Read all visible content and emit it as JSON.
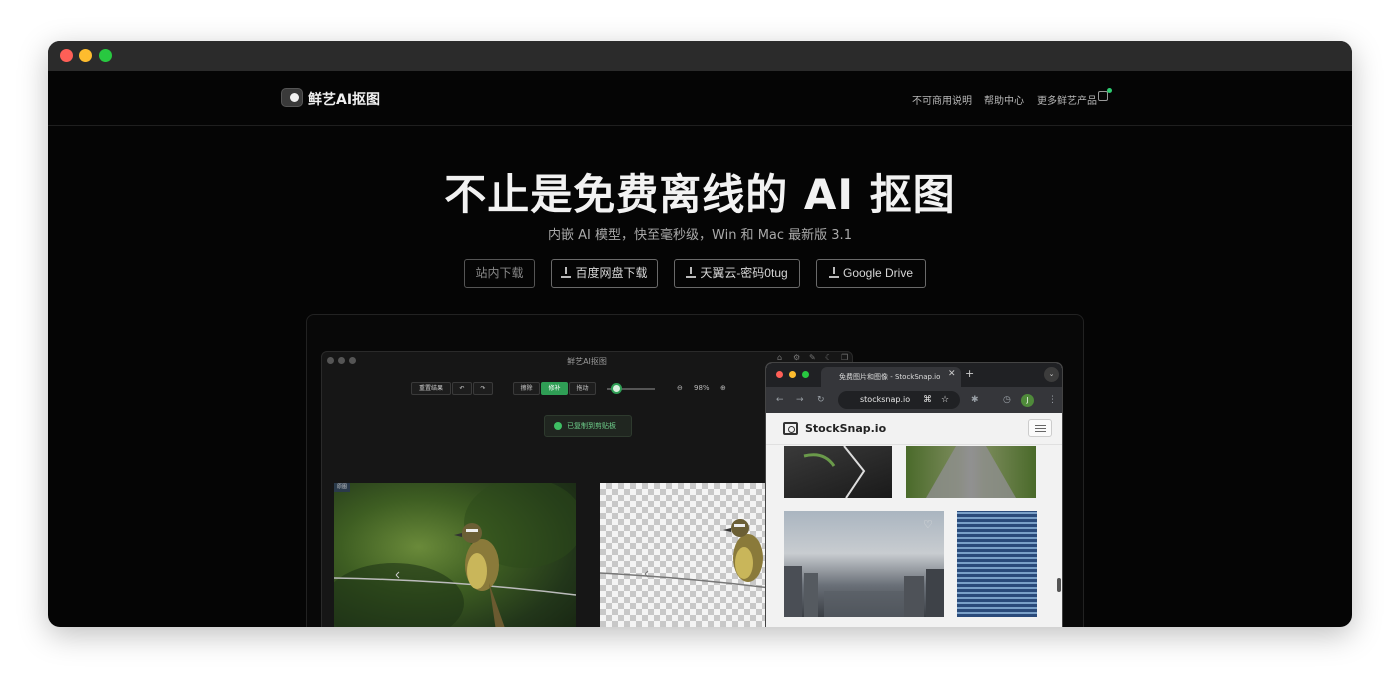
{
  "window": {
    "traffic_lights": [
      "#ff5f57",
      "#febc2e",
      "#28c840"
    ]
  },
  "navbar": {
    "logo_text": "鲜艺AI抠图",
    "links": [
      "不可商用说明",
      "帮助中心",
      "更多鲜艺产品"
    ]
  },
  "hero": {
    "title": "不止是免费离线的 AI 抠图",
    "subtitle": "内嵌 AI 模型，快至毫秒级，Win 和 Mac 最新版 3.1",
    "buttons": [
      "站内下载",
      "百度网盘下载",
      "天翼云-密码0tug",
      "Google Drive"
    ]
  },
  "preview": {
    "app": {
      "title": "鲜艺AI抠图",
      "toolbar": [
        "重置结果",
        "擦除",
        "修补",
        "拖动"
      ],
      "zoom": "98%",
      "toast": "已复制到剪贴板",
      "tag": "原图"
    },
    "browser": {
      "tab_title": "免费图片和图像 - StockSnap.io",
      "url": "stocksnap.io",
      "site_name": "StockSnap.io",
      "avatar_letter": "J"
    }
  }
}
